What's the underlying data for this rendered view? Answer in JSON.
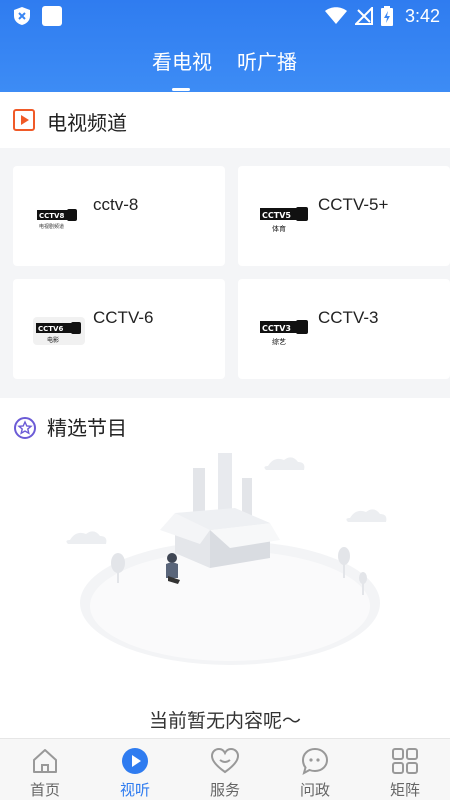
{
  "status_bar": {
    "time": "3:42",
    "icons": [
      "shield-icon",
      "app-square-icon",
      "wifi-icon",
      "signal-icon",
      "battery-charging-icon"
    ]
  },
  "top_tabs": [
    {
      "label": "看电视",
      "active": true
    },
    {
      "label": "听广播",
      "active": false
    }
  ],
  "tv_section": {
    "title": "电视频道",
    "icon": "play-square-icon",
    "accent_color": "#f05a28",
    "channels": [
      {
        "name": "cctv-8",
        "logo_text": "CCTV8",
        "logo_sub": "电视剧频道"
      },
      {
        "name": "CCTV-5+",
        "logo_text": "CCTV5",
        "logo_sub": "体育"
      },
      {
        "name": "CCTV-6",
        "logo_text": "CCTV6",
        "logo_sub": "电影"
      },
      {
        "name": "CCTV-3",
        "logo_text": "CCTV3",
        "logo_sub": "综艺"
      }
    ]
  },
  "featured_section": {
    "title": "精选节目",
    "icon": "star-circle-icon",
    "empty_text": "当前暂无内容呢～"
  },
  "bottom_nav": {
    "active_color": "#2f7cf0",
    "items": [
      {
        "label": "首页",
        "icon": "home-icon",
        "active": false
      },
      {
        "label": "视听",
        "icon": "play-circle-icon",
        "active": true
      },
      {
        "label": "服务",
        "icon": "heart-icon",
        "active": false
      },
      {
        "label": "问政",
        "icon": "chat-bubble-icon",
        "active": false
      },
      {
        "label": "矩阵",
        "icon": "grid-icon",
        "active": false
      }
    ]
  }
}
